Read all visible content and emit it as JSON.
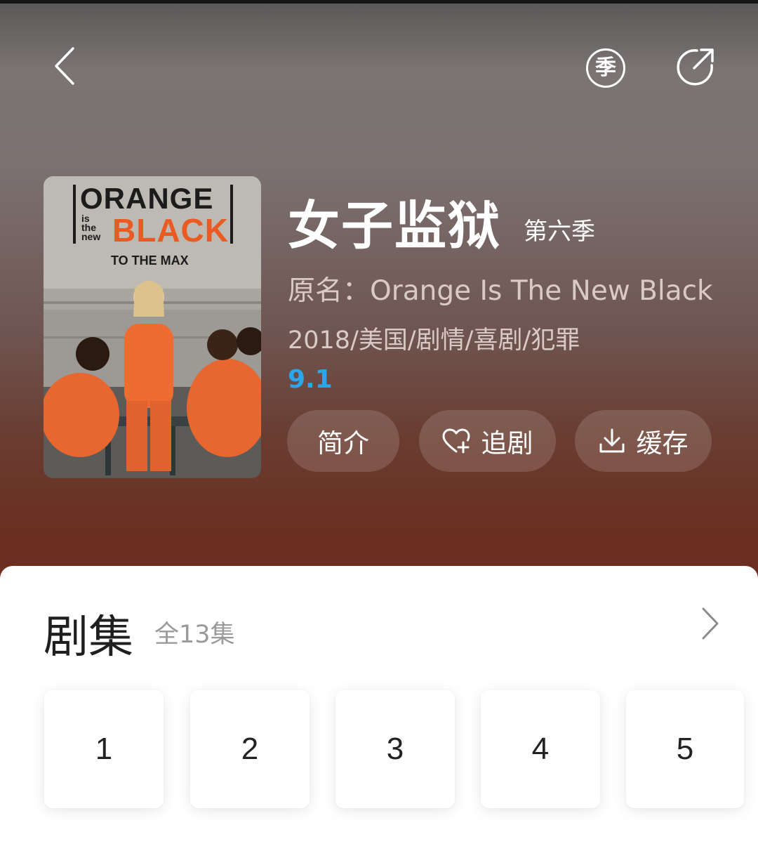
{
  "icons": {
    "back": "chevron-left-icon",
    "season": "season-icon",
    "share": "share-icon",
    "follow": "heart-plus-icon",
    "download": "download-icon",
    "more": "chevron-right-icon"
  },
  "header": {
    "season_badge": "季"
  },
  "poster": {
    "line1": "ORANGE",
    "line2_small": "is\nthe\nnew",
    "line2_big": "BLACK",
    "tagline": "TO THE MAX"
  },
  "show": {
    "title": "女子监狱",
    "season": "第六季",
    "original_name": "原名：Orange Is The New Black",
    "meta": "2018/美国/剧情/喜剧/犯罪",
    "rating": "9.1"
  },
  "actions": {
    "intro_label": "简介",
    "follow_label": "追剧",
    "cache_label": "缓存"
  },
  "episodes": {
    "title": "剧集",
    "count": "全13集",
    "items": [
      "1",
      "2",
      "3",
      "4",
      "5"
    ]
  },
  "colors": {
    "rating": "#2aa7ec",
    "poster_accent": "#ea5a23"
  }
}
